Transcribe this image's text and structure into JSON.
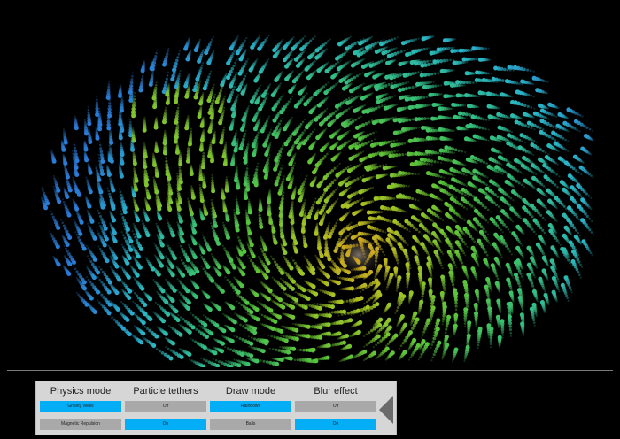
{
  "controls": [
    {
      "title": "Physics mode",
      "options": [
        "Gravity Wells",
        "Magnetic Repulsion"
      ],
      "selected": 0
    },
    {
      "title": "Particle tethers",
      "options": [
        "Off",
        "On"
      ],
      "selected": 1
    },
    {
      "title": "Draw mode",
      "options": [
        "Rainbows",
        "Balls"
      ],
      "selected": 0
    },
    {
      "title": "Blur effect",
      "options": [
        "Off",
        "On"
      ],
      "selected": 1
    }
  ],
  "colors": {
    "background": "#000000",
    "panel": "#d6d6d6",
    "option_selected": "#04aef7",
    "option_unselected": "#a9a9a9",
    "particle_palette": [
      "#2a7bd6",
      "#2ab6c9",
      "#35c07a",
      "#58c43a",
      "#a5c423",
      "#d8a21f"
    ]
  },
  "icons": {
    "collapse": "triangle-left-icon"
  }
}
